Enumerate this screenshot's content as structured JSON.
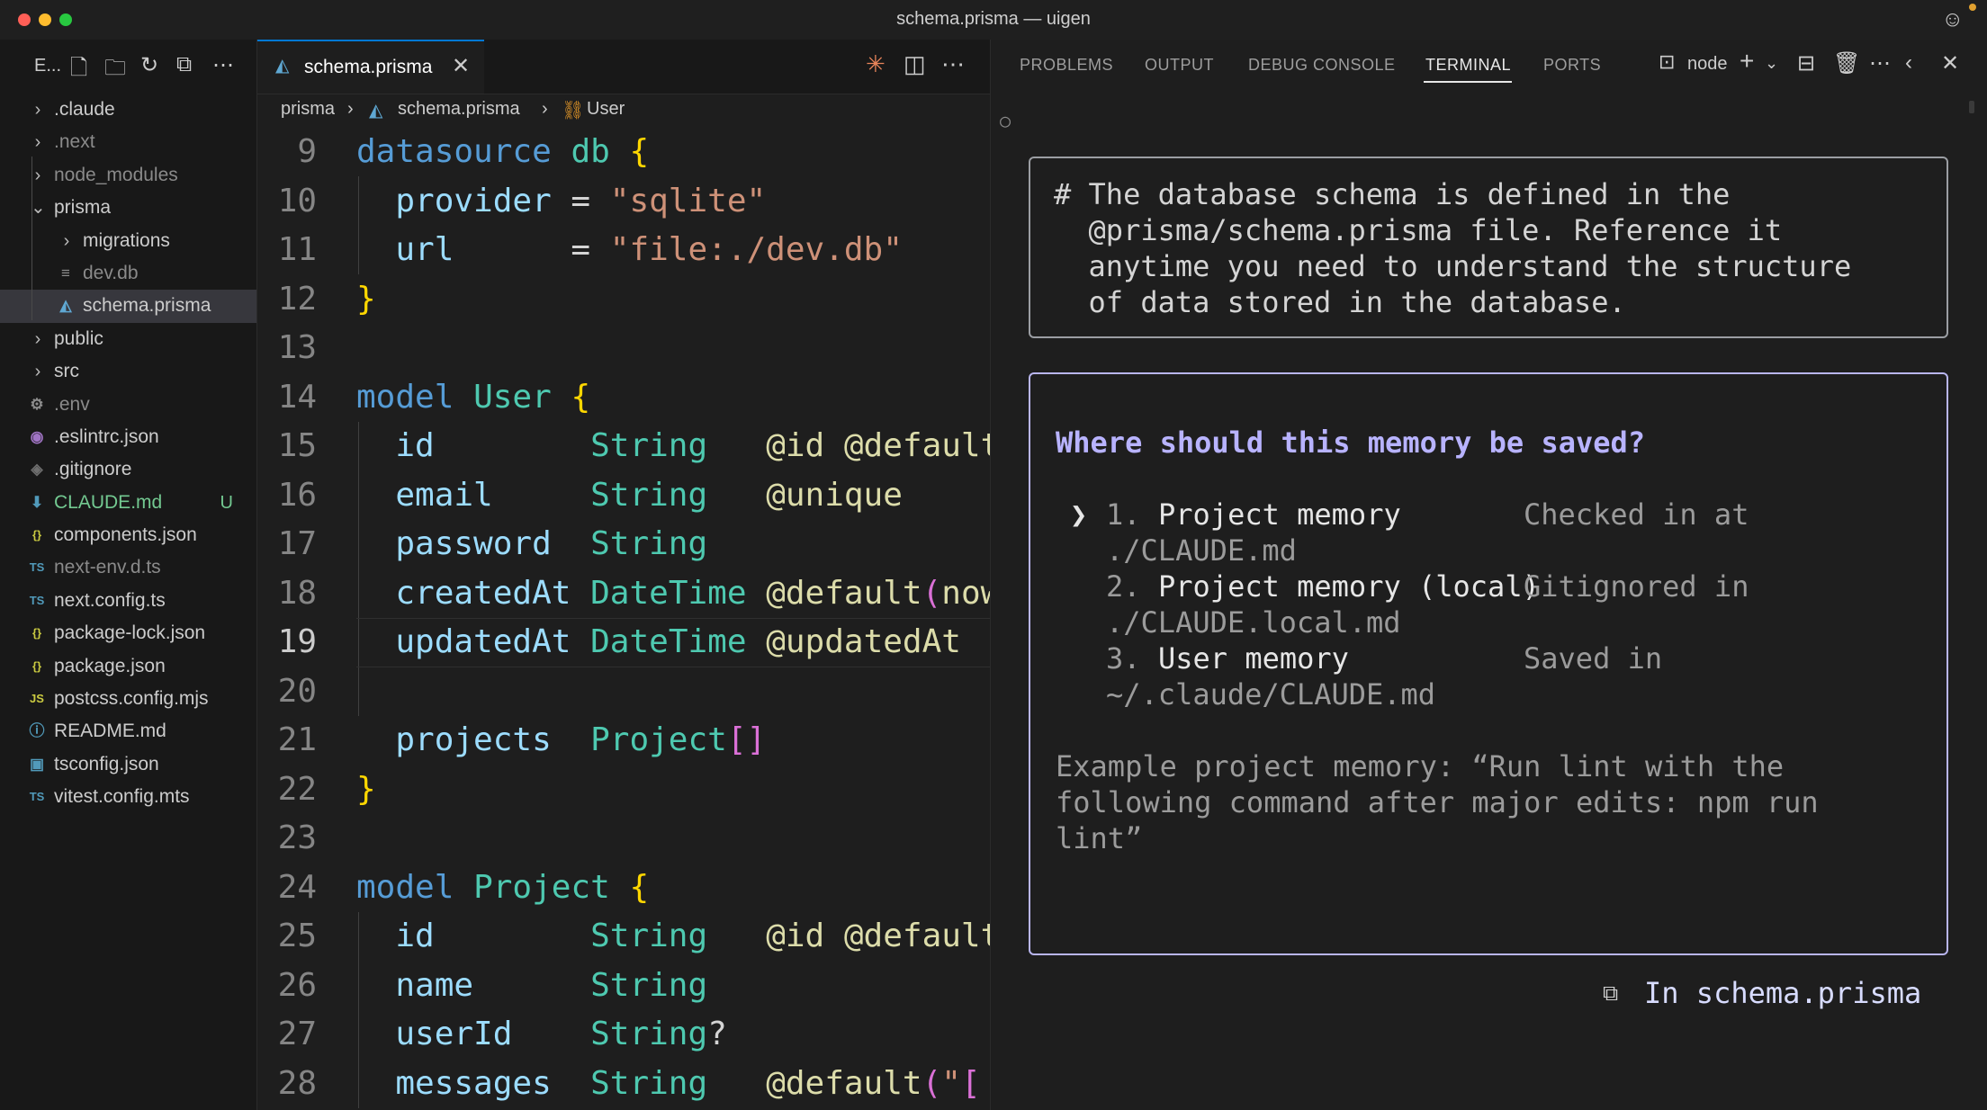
{
  "window": {
    "title": "schema.prisma — uigen"
  },
  "colors": {
    "close": "#ff5f57",
    "minimize": "#febc2e",
    "maximize": "#28c840",
    "accent": "#0078d4",
    "modified": "#73c991"
  },
  "explorer": {
    "title": "E...",
    "items": [
      {
        "label": ".claude",
        "type": "folder",
        "depth": 0,
        "open": false
      },
      {
        "label": ".next",
        "type": "folder",
        "depth": 0,
        "open": false,
        "dim": true
      },
      {
        "label": "node_modules",
        "type": "folder",
        "depth": 0,
        "open": false,
        "dim": true
      },
      {
        "label": "prisma",
        "type": "folder",
        "depth": 0,
        "open": true
      },
      {
        "label": "migrations",
        "type": "folder",
        "depth": 1,
        "open": false
      },
      {
        "label": "dev.db",
        "type": "file",
        "depth": 1,
        "icon": "db-file-icon",
        "glyph": "≡",
        "color": "#8c8c8c",
        "dim": true
      },
      {
        "label": "schema.prisma",
        "type": "file",
        "depth": 1,
        "icon": "prisma-icon",
        "glyph": "◭",
        "color": "#5fa8d3",
        "selected": true
      },
      {
        "label": "public",
        "type": "folder",
        "depth": 0,
        "open": false
      },
      {
        "label": "src",
        "type": "folder",
        "depth": 0,
        "open": false
      },
      {
        "label": ".env",
        "type": "file",
        "depth": 0,
        "icon": "gear-icon",
        "glyph": "⚙",
        "color": "#8c8c8c",
        "dim": true
      },
      {
        "label": ".eslintrc.json",
        "type": "file",
        "depth": 0,
        "icon": "eslint-icon",
        "glyph": "◉",
        "color": "#a074c4"
      },
      {
        "label": ".gitignore",
        "type": "file",
        "depth": 0,
        "icon": "git-icon",
        "glyph": "◈",
        "color": "#6e6e6e"
      },
      {
        "label": "CLAUDE.md",
        "type": "file",
        "depth": 0,
        "icon": "markdown-download-icon",
        "glyph": "⬇",
        "color": "#519aba",
        "badge": "U",
        "modified": true
      },
      {
        "label": "components.json",
        "type": "file",
        "depth": 0,
        "icon": "json-icon",
        "glyph": "{}",
        "color": "#cbcb41"
      },
      {
        "label": "next-env.d.ts",
        "type": "file",
        "depth": 0,
        "icon": "ts-icon",
        "glyph": "TS",
        "color": "#519aba",
        "dim": true
      },
      {
        "label": "next.config.ts",
        "type": "file",
        "depth": 0,
        "icon": "ts-icon",
        "glyph": "TS",
        "color": "#519aba"
      },
      {
        "label": "package-lock.json",
        "type": "file",
        "depth": 0,
        "icon": "json-icon",
        "glyph": "{}",
        "color": "#cbcb41"
      },
      {
        "label": "package.json",
        "type": "file",
        "depth": 0,
        "icon": "json-icon",
        "glyph": "{}",
        "color": "#cbcb41"
      },
      {
        "label": "postcss.config.mjs",
        "type": "file",
        "depth": 0,
        "icon": "js-icon",
        "glyph": "JS",
        "color": "#cbcb41"
      },
      {
        "label": "README.md",
        "type": "file",
        "depth": 0,
        "icon": "info-icon",
        "glyph": "ⓘ",
        "color": "#519aba"
      },
      {
        "label": "tsconfig.json",
        "type": "file",
        "depth": 0,
        "icon": "tsconfig-icon",
        "glyph": "▣",
        "color": "#519aba"
      },
      {
        "label": "vitest.config.mts",
        "type": "file",
        "depth": 0,
        "icon": "ts-icon",
        "glyph": "TS",
        "color": "#519aba"
      }
    ]
  },
  "editor": {
    "tab": {
      "label": "schema.prisma"
    },
    "breadcrumb": [
      "prisma",
      "schema.prisma",
      "User"
    ],
    "current_line": 19,
    "lines": [
      {
        "n": "9",
        "tokens": [
          [
            "kw",
            "datasource"
          ],
          [
            "op",
            " "
          ],
          [
            "ty",
            "db"
          ],
          [
            "op",
            " "
          ],
          [
            "br",
            "{"
          ]
        ]
      },
      {
        "n": "10",
        "tokens": [
          [
            "op",
            "  "
          ],
          [
            "pr",
            "provider"
          ],
          [
            "op",
            " = "
          ],
          [
            "st",
            "\"sqlite\""
          ]
        ]
      },
      {
        "n": "11",
        "tokens": [
          [
            "op",
            "  "
          ],
          [
            "pr",
            "url"
          ],
          [
            "op",
            "      = "
          ],
          [
            "st",
            "\"file:./dev.db\""
          ]
        ]
      },
      {
        "n": "12",
        "tokens": [
          [
            "br",
            "}"
          ]
        ]
      },
      {
        "n": "13",
        "tokens": []
      },
      {
        "n": "14",
        "tokens": [
          [
            "kw",
            "model"
          ],
          [
            "op",
            " "
          ],
          [
            "ty",
            "User"
          ],
          [
            "op",
            " "
          ],
          [
            "br",
            "{"
          ]
        ]
      },
      {
        "n": "15",
        "tokens": [
          [
            "op",
            "  "
          ],
          [
            "pr",
            "id"
          ],
          [
            "op",
            "        "
          ],
          [
            "ty",
            "String"
          ],
          [
            "op",
            "   "
          ],
          [
            "at",
            "@id @default"
          ]
        ]
      },
      {
        "n": "16",
        "tokens": [
          [
            "op",
            "  "
          ],
          [
            "pr",
            "email"
          ],
          [
            "op",
            "     "
          ],
          [
            "ty",
            "String"
          ],
          [
            "op",
            "   "
          ],
          [
            "at",
            "@unique"
          ]
        ]
      },
      {
        "n": "17",
        "tokens": [
          [
            "op",
            "  "
          ],
          [
            "pr",
            "password"
          ],
          [
            "op",
            "  "
          ],
          [
            "ty",
            "String"
          ]
        ]
      },
      {
        "n": "18",
        "tokens": [
          [
            "op",
            "  "
          ],
          [
            "pr",
            "createdAt"
          ],
          [
            "op",
            " "
          ],
          [
            "ty",
            "DateTime"
          ],
          [
            "op",
            " "
          ],
          [
            "at",
            "@default"
          ],
          [
            "pn",
            "("
          ],
          [
            "at",
            "now"
          ]
        ]
      },
      {
        "n": "19",
        "tokens": [
          [
            "op",
            "  "
          ],
          [
            "pr",
            "updatedAt"
          ],
          [
            "op",
            " "
          ],
          [
            "ty",
            "DateTime"
          ],
          [
            "op",
            " "
          ],
          [
            "at",
            "@updatedAt"
          ]
        ]
      },
      {
        "n": "20",
        "tokens": []
      },
      {
        "n": "21",
        "tokens": [
          [
            "op",
            "  "
          ],
          [
            "pr",
            "projects"
          ],
          [
            "op",
            "  "
          ],
          [
            "ty",
            "Project"
          ],
          [
            "pn",
            "[]"
          ]
        ]
      },
      {
        "n": "22",
        "tokens": [
          [
            "br",
            "}"
          ]
        ]
      },
      {
        "n": "23",
        "tokens": []
      },
      {
        "n": "24",
        "tokens": [
          [
            "kw",
            "model"
          ],
          [
            "op",
            " "
          ],
          [
            "ty",
            "Project"
          ],
          [
            "op",
            " "
          ],
          [
            "br",
            "{"
          ]
        ]
      },
      {
        "n": "25",
        "tokens": [
          [
            "op",
            "  "
          ],
          [
            "pr",
            "id"
          ],
          [
            "op",
            "        "
          ],
          [
            "ty",
            "String"
          ],
          [
            "op",
            "   "
          ],
          [
            "at",
            "@id @default"
          ]
        ]
      },
      {
        "n": "26",
        "tokens": [
          [
            "op",
            "  "
          ],
          [
            "pr",
            "name"
          ],
          [
            "op",
            "      "
          ],
          [
            "ty",
            "String"
          ]
        ]
      },
      {
        "n": "27",
        "tokens": [
          [
            "op",
            "  "
          ],
          [
            "pr",
            "userId"
          ],
          [
            "op",
            "    "
          ],
          [
            "ty",
            "String"
          ],
          [
            "op",
            "?"
          ]
        ]
      },
      {
        "n": "28",
        "tokens": [
          [
            "op",
            "  "
          ],
          [
            "pr",
            "messages"
          ],
          [
            "op",
            "  "
          ],
          [
            "ty",
            "String"
          ],
          [
            "op",
            "   "
          ],
          [
            "at",
            "@default"
          ],
          [
            "pn",
            "("
          ],
          [
            "st",
            "\""
          ],
          [
            "pn",
            "["
          ]
        ]
      }
    ]
  },
  "panel": {
    "tabs": [
      "PROBLEMS",
      "OUTPUT",
      "DEBUG CONSOLE",
      "TERMINAL",
      "PORTS"
    ],
    "active_tab": "TERMINAL",
    "terminal_name": "node",
    "prompt_glyph": "○",
    "info_box": "# The database schema is defined in the\n  @prisma/schema.prisma file. Reference it\n  anytime you need to understand the structure\n  of data stored in the database.",
    "question": "Where should this memory be saved?",
    "options": [
      {
        "cursor": "❯",
        "number": "1.",
        "label": "Project memory",
        "desc": "Checked in at",
        "path": "./CLAUDE.md"
      },
      {
        "cursor": "",
        "number": "2.",
        "label": "Project memory (local)",
        "desc": "Gitignored in",
        "path": "./CLAUDE.local.md"
      },
      {
        "cursor": "",
        "number": "3.",
        "label": "User memory",
        "desc": "Saved in",
        "path": "~/.claude/CLAUDE.md"
      }
    ],
    "example": "Example project memory: “Run lint with the\nfollowing command after major edits: npm run\nlint”",
    "context": "In schema.prisma"
  }
}
